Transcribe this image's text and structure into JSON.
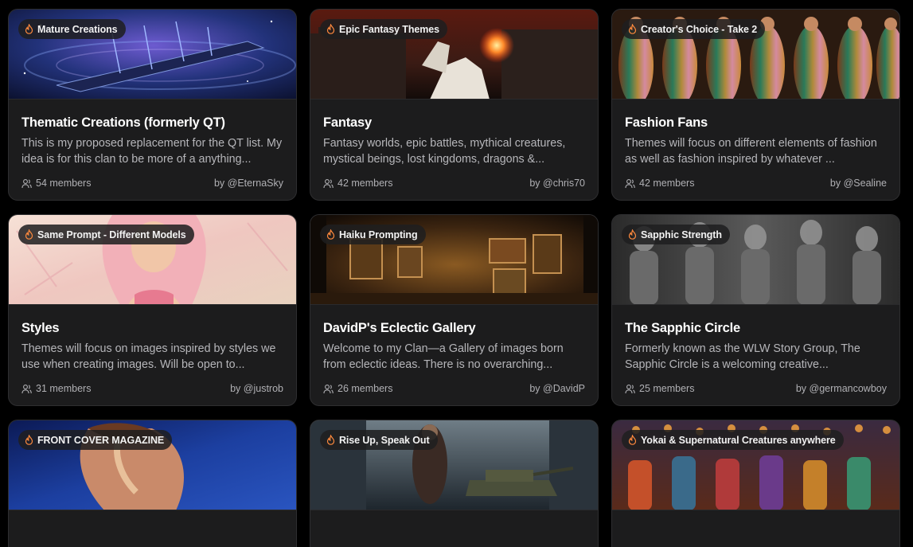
{
  "cards": [
    {
      "tag": "Mature Creations",
      "title": "Thematic Creations (formerly QT)",
      "description": "This is my proposed replacement for the QT list. My idea is for this clan to be more of a anything...",
      "members": "54 members",
      "author": "by @EternaSky",
      "palette": {
        "a": "#1a2a6b",
        "b": "#5b3f9e",
        "c": "#0e1433",
        "accent": "#9fb7ff"
      }
    },
    {
      "tag": "Epic Fantasy Themes",
      "title": "Fantasy",
      "description": "Fantasy worlds, epic battles, mythical creatures, mystical beings, lost kingdoms, dragons &...",
      "members": "42 members",
      "author": "by @chris70",
      "palette": {
        "a": "#3a1712",
        "b": "#8a2a14",
        "c": "#1a0d0b",
        "accent": "#ff7a2e"
      }
    },
    {
      "tag": "Creator's Choice - Take 2",
      "title": "Fashion Fans",
      "description": "Themes will focus on different elements of fashion as well as fashion inspired by whatever ...",
      "members": "42 members",
      "author": "by @Sealine",
      "palette": {
        "a": "#6b3a1e",
        "b": "#d4a24a",
        "c": "#2a1a10",
        "accent": "#e8c27a"
      }
    },
    {
      "tag": "Same Prompt - Different Models",
      "title": "Styles",
      "description": "Themes will focus on images inspired by styles we use when creating images. Will be open to...",
      "members": "31 members",
      "author": "by @justrob",
      "palette": {
        "a": "#f1d8c9",
        "b": "#e9a8a8",
        "c": "#d9b9a2",
        "accent": "#f4c27c"
      }
    },
    {
      "tag": "Haiku Prompting",
      "title": "DavidP's Eclectic Gallery",
      "description": "Welcome to my Clan—a Gallery of images born from eclectic ideas. There is no overarching...",
      "members": "26 members",
      "author": "by @DavidP",
      "palette": {
        "a": "#3b2410",
        "b": "#8a5a22",
        "c": "#1a1108",
        "accent": "#e6b15a"
      }
    },
    {
      "tag": "Sapphic Strength",
      "title": "The Sapphic Circle",
      "description": "Formerly known as the WLW Story Group, The Sapphic Circle is a welcoming creative...",
      "members": "25 members",
      "author": "by @germancowboy",
      "palette": {
        "a": "#3a3a3a",
        "b": "#8a8a8a",
        "c": "#1a1a1a",
        "accent": "#cfcfcf"
      }
    },
    {
      "tag": "FRONT COVER MAGAZINE",
      "title": "",
      "description": "",
      "members": "",
      "author": "",
      "palette": {
        "a": "#1c3fa0",
        "b": "#c98a6a",
        "c": "#0c1a55",
        "accent": "#e0b090"
      }
    },
    {
      "tag": "Rise Up, Speak Out",
      "title": "",
      "description": "",
      "members": "",
      "author": "",
      "palette": {
        "a": "#3c4a55",
        "b": "#6f7d86",
        "c": "#1d252c",
        "accent": "#c9a27a"
      }
    },
    {
      "tag": "Yokai & Supernatural Creatures anywhere",
      "title": "",
      "description": "",
      "members": "",
      "author": "",
      "palette": {
        "a": "#5a2a1a",
        "b": "#c4502a",
        "c": "#1f1a30",
        "accent": "#f0a040"
      }
    }
  ]
}
